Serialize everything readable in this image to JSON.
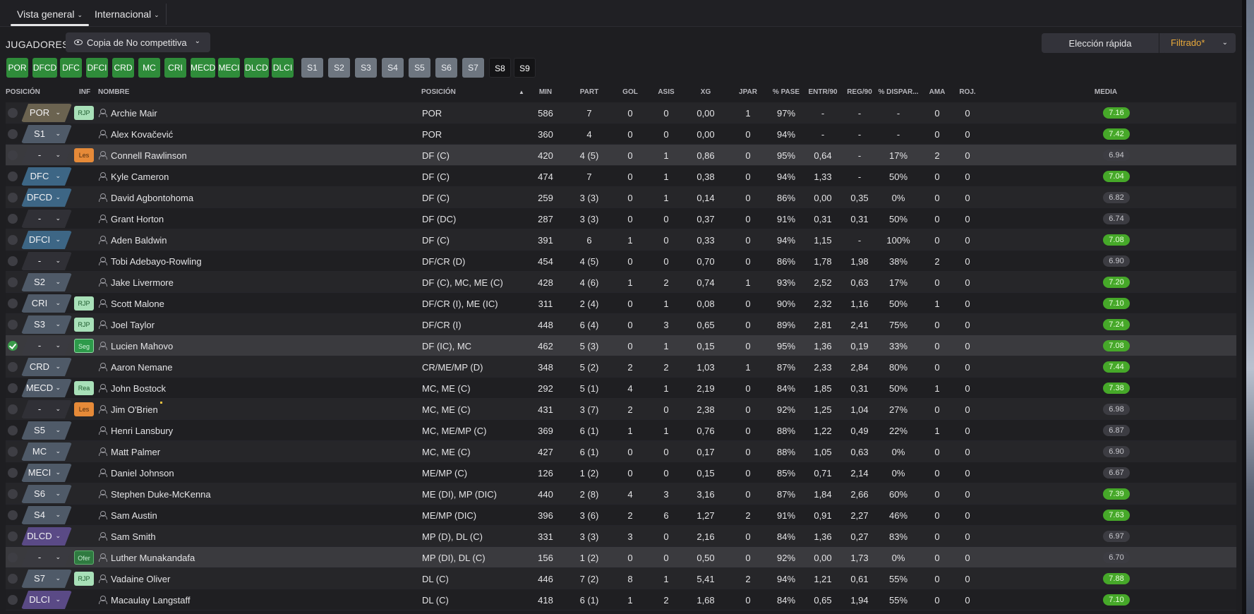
{
  "tabs": [
    {
      "label": "Vista general",
      "active": true
    },
    {
      "label": "Internacional",
      "active": false
    }
  ],
  "toolbar": {
    "title": "JUGADORES",
    "view_select": "Copia de No competitiva",
    "quick_select": "Elección rápida",
    "filtered": "Filtrado*"
  },
  "chips": [
    {
      "label": "POR",
      "style": "green"
    },
    {
      "label": "DFCD",
      "style": "green"
    },
    {
      "label": "DFC",
      "style": "green"
    },
    {
      "label": "DFCI",
      "style": "green"
    },
    {
      "label": "CRD",
      "style": "green"
    },
    {
      "label": "MC",
      "style": "green"
    },
    {
      "label": "CRI",
      "style": "green"
    },
    {
      "label": "MECD",
      "style": "green"
    },
    {
      "label": "MECI",
      "style": "green"
    },
    {
      "label": "DLCD",
      "style": "green"
    },
    {
      "label": "DLCI",
      "style": "green"
    },
    {
      "label": "S1",
      "style": "gray"
    },
    {
      "label": "S2",
      "style": "gray"
    },
    {
      "label": "S3",
      "style": "gray"
    },
    {
      "label": "S4",
      "style": "gray"
    },
    {
      "label": "S5",
      "style": "gray"
    },
    {
      "label": "S6",
      "style": "gray"
    },
    {
      "label": "S7",
      "style": "gray"
    },
    {
      "label": "S8",
      "style": "black"
    },
    {
      "label": "S9",
      "style": "black"
    }
  ],
  "columns": {
    "posicion": "POSICIÓN",
    "inf": "INF",
    "nombre": "NOMBRE",
    "posicion2": "POSICIÓN",
    "min": "MIN",
    "part": "PART",
    "gol": "GOL",
    "asis": "ASIS",
    "xg": "XG",
    "jpar": "JPAR",
    "pase": "% PASE",
    "entr": "ENTR/90",
    "reg": "REG/90",
    "dispar": "% DISPAR...",
    "ama": "AMA",
    "roj": "ROJ.",
    "media": "MEDIA"
  },
  "sort_indicator": "▲",
  "players": [
    {
      "slot": "POR",
      "slot_color": "#6b6350",
      "inf": "RJP",
      "inf_type": "rjp",
      "name": "Archie Mair",
      "position": "POR",
      "min": "586",
      "part": "7",
      "gol": "0",
      "asis": "0",
      "xg": "0,00",
      "jpar": "1",
      "pase": "97%",
      "entr": "-",
      "reg": "-",
      "dispar": "-",
      "ama": "0",
      "roj": "0",
      "media": "7.16",
      "media_type": "g",
      "checked": false
    },
    {
      "slot": "S1",
      "slot_color": "#4f5a68",
      "inf": "",
      "inf_type": "",
      "name": "Alex Kovačević",
      "position": "POR",
      "min": "360",
      "part": "4",
      "gol": "0",
      "asis": "0",
      "xg": "0,00",
      "jpar": "0",
      "pase": "94%",
      "entr": "-",
      "reg": "-",
      "dispar": "-",
      "ama": "0",
      "roj": "0",
      "media": "7.42",
      "media_type": "g",
      "checked": false
    },
    {
      "slot": "-",
      "slot_color": "#3a3a40",
      "inf": "Les",
      "inf_type": "les",
      "name": "Connell Rawlinson",
      "position": "DF (C)",
      "min": "420",
      "part": "4 (5)",
      "gol": "0",
      "asis": "1",
      "xg": "0,86",
      "jpar": "0",
      "pase": "95%",
      "entr": "0,64",
      "reg": "-",
      "dispar": "17%",
      "ama": "2",
      "roj": "0",
      "media": "6.94",
      "media_type": "n",
      "checked": false,
      "highlight": true
    },
    {
      "slot": "DFC",
      "slot_color": "#3d6685",
      "inf": "",
      "inf_type": "",
      "name": "Kyle Cameron",
      "position": "DF (C)",
      "min": "474",
      "part": "7",
      "gol": "0",
      "asis": "1",
      "xg": "0,38",
      "jpar": "0",
      "pase": "94%",
      "entr": "1,33",
      "reg": "-",
      "dispar": "50%",
      "ama": "0",
      "roj": "0",
      "media": "7.04",
      "media_type": "g",
      "checked": false
    },
    {
      "slot": "DFCD",
      "slot_color": "#3d6685",
      "inf": "",
      "inf_type": "",
      "name": "David Agbontohoma",
      "position": "DF (C)",
      "min": "259",
      "part": "3 (3)",
      "gol": "0",
      "asis": "1",
      "xg": "0,14",
      "jpar": "0",
      "pase": "86%",
      "entr": "0,00",
      "reg": "0,35",
      "dispar": "0%",
      "ama": "0",
      "roj": "0",
      "media": "6.82",
      "media_type": "n",
      "checked": false
    },
    {
      "slot": "-",
      "slot_color": "#303036",
      "inf": "",
      "inf_type": "",
      "name": "Grant Horton",
      "position": "DF (DC)",
      "min": "287",
      "part": "3 (3)",
      "gol": "0",
      "asis": "0",
      "xg": "0,37",
      "jpar": "0",
      "pase": "91%",
      "entr": "0,31",
      "reg": "0,31",
      "dispar": "50%",
      "ama": "0",
      "roj": "0",
      "media": "6.74",
      "media_type": "n",
      "checked": false
    },
    {
      "slot": "DFCI",
      "slot_color": "#3d6685",
      "inf": "",
      "inf_type": "",
      "name": "Aden Baldwin",
      "position": "DF (C)",
      "min": "391",
      "part": "6",
      "gol": "1",
      "asis": "0",
      "xg": "0,33",
      "jpar": "0",
      "pase": "94%",
      "entr": "1,15",
      "reg": "-",
      "dispar": "100%",
      "ama": "0",
      "roj": "0",
      "media": "7.08",
      "media_type": "g",
      "checked": false
    },
    {
      "slot": "-",
      "slot_color": "#303036",
      "inf": "",
      "inf_type": "",
      "name": "Tobi Adebayo-Rowling",
      "position": "DF/CR (D)",
      "min": "454",
      "part": "4 (5)",
      "gol": "0",
      "asis": "0",
      "xg": "0,70",
      "jpar": "0",
      "pase": "86%",
      "entr": "1,78",
      "reg": "1,98",
      "dispar": "38%",
      "ama": "2",
      "roj": "0",
      "media": "6.90",
      "media_type": "n",
      "checked": false
    },
    {
      "slot": "S2",
      "slot_color": "#4f5a68",
      "inf": "",
      "inf_type": "",
      "name": "Jake Livermore",
      "position": "DF (C), MC, ME (C)",
      "min": "428",
      "part": "4 (6)",
      "gol": "1",
      "asis": "2",
      "xg": "0,74",
      "jpar": "1",
      "pase": "93%",
      "entr": "2,52",
      "reg": "0,63",
      "dispar": "17%",
      "ama": "0",
      "roj": "0",
      "media": "7.20",
      "media_type": "g",
      "checked": false
    },
    {
      "slot": "CRI",
      "slot_color": "#4f5a68",
      "inf": "RJP",
      "inf_type": "rjp",
      "name": "Scott Malone",
      "position": "DF/CR (I), ME (IC)",
      "min": "311",
      "part": "2 (4)",
      "gol": "0",
      "asis": "1",
      "xg": "0,08",
      "jpar": "0",
      "pase": "90%",
      "entr": "2,32",
      "reg": "1,16",
      "dispar": "50%",
      "ama": "1",
      "roj": "0",
      "media": "7.10",
      "media_type": "g",
      "checked": false
    },
    {
      "slot": "S3",
      "slot_color": "#4f5a68",
      "inf": "RJP",
      "inf_type": "rjp",
      "name": "Joel Taylor",
      "position": "DF/CR (I)",
      "min": "448",
      "part": "6 (4)",
      "gol": "0",
      "asis": "3",
      "xg": "0,65",
      "jpar": "0",
      "pase": "89%",
      "entr": "2,81",
      "reg": "2,41",
      "dispar": "75%",
      "ama": "0",
      "roj": "0",
      "media": "7.24",
      "media_type": "g",
      "checked": false
    },
    {
      "slot": "-",
      "slot_color": "#3a3a40",
      "inf": "Seg",
      "inf_type": "seg",
      "name": "Lucien Mahovo",
      "position": "DF (IC), MC",
      "min": "462",
      "part": "5 (3)",
      "gol": "0",
      "asis": "1",
      "xg": "0,15",
      "jpar": "0",
      "pase": "95%",
      "entr": "1,36",
      "reg": "0,19",
      "dispar": "33%",
      "ama": "0",
      "roj": "0",
      "media": "7.08",
      "media_type": "g",
      "checked": true,
      "highlight": true
    },
    {
      "slot": "CRD",
      "slot_color": "#4f5a68",
      "inf": "",
      "inf_type": "",
      "name": "Aaron Nemane",
      "position": "CR/ME/MP (D)",
      "min": "348",
      "part": "5 (2)",
      "gol": "2",
      "asis": "2",
      "xg": "1,03",
      "jpar": "1",
      "pase": "87%",
      "entr": "2,33",
      "reg": "2,84",
      "dispar": "80%",
      "ama": "0",
      "roj": "0",
      "media": "7.44",
      "media_type": "g",
      "checked": false
    },
    {
      "slot": "MECD",
      "slot_color": "#4f5a68",
      "inf": "Rea",
      "inf_type": "rea",
      "name": "John Bostock",
      "position": "MC, ME (C)",
      "min": "292",
      "part": "5 (1)",
      "gol": "4",
      "asis": "1",
      "xg": "2,19",
      "jpar": "0",
      "pase": "84%",
      "entr": "1,85",
      "reg": "0,31",
      "dispar": "50%",
      "ama": "1",
      "roj": "0",
      "media": "7.38",
      "media_type": "g",
      "checked": false
    },
    {
      "slot": "-",
      "slot_color": "#303036",
      "inf": "Les",
      "inf_type": "les",
      "name": "Jim O'Brien",
      "position": "MC, ME (C)",
      "min": "431",
      "part": "3 (7)",
      "gol": "2",
      "asis": "0",
      "xg": "2,38",
      "jpar": "0",
      "pase": "92%",
      "entr": "1,25",
      "reg": "1,04",
      "dispar": "27%",
      "ama": "0",
      "roj": "0",
      "media": "6.98",
      "media_type": "n",
      "checked": false
    },
    {
      "slot": "S5",
      "slot_color": "#4f5a68",
      "inf": "",
      "inf_type": "",
      "name": "Henri Lansbury",
      "position": "MC, ME/MP (C)",
      "min": "369",
      "part": "6 (1)",
      "gol": "1",
      "asis": "1",
      "xg": "0,76",
      "jpar": "0",
      "pase": "88%",
      "entr": "1,22",
      "reg": "0,49",
      "dispar": "22%",
      "ama": "1",
      "roj": "0",
      "media": "6.87",
      "media_type": "n",
      "checked": false
    },
    {
      "slot": "MC",
      "slot_color": "#4f5a68",
      "inf": "",
      "inf_type": "",
      "name": "Matt Palmer",
      "position": "MC, ME (C)",
      "min": "427",
      "part": "6 (1)",
      "gol": "0",
      "asis": "0",
      "xg": "0,17",
      "jpar": "0",
      "pase": "88%",
      "entr": "1,05",
      "reg": "0,63",
      "dispar": "0%",
      "ama": "0",
      "roj": "0",
      "media": "6.90",
      "media_type": "n",
      "checked": false
    },
    {
      "slot": "MECI",
      "slot_color": "#4f5a68",
      "inf": "",
      "inf_type": "",
      "name": "Daniel Johnson",
      "position": "ME/MP (C)",
      "min": "126",
      "part": "1 (2)",
      "gol": "0",
      "asis": "0",
      "xg": "0,15",
      "jpar": "0",
      "pase": "85%",
      "entr": "0,71",
      "reg": "2,14",
      "dispar": "0%",
      "ama": "0",
      "roj": "0",
      "media": "6.67",
      "media_type": "n",
      "checked": false
    },
    {
      "slot": "S6",
      "slot_color": "#4f5a68",
      "inf": "",
      "inf_type": "",
      "name": "Stephen Duke-McKenna",
      "position": "ME (DI), MP (DIC)",
      "min": "440",
      "part": "2 (8)",
      "gol": "4",
      "asis": "3",
      "xg": "3,16",
      "jpar": "0",
      "pase": "87%",
      "entr": "1,84",
      "reg": "2,66",
      "dispar": "60%",
      "ama": "0",
      "roj": "0",
      "media": "7.39",
      "media_type": "g",
      "checked": false
    },
    {
      "slot": "S4",
      "slot_color": "#4f5a68",
      "inf": "",
      "inf_type": "",
      "name": "Sam Austin",
      "position": "ME/MP (DIC)",
      "min": "396",
      "part": "3 (6)",
      "gol": "2",
      "asis": "6",
      "xg": "1,27",
      "jpar": "2",
      "pase": "91%",
      "entr": "0,91",
      "reg": "2,27",
      "dispar": "46%",
      "ama": "0",
      "roj": "0",
      "media": "7.63",
      "media_type": "g",
      "checked": false
    },
    {
      "slot": "DLCD",
      "slot_color": "#5a4a86",
      "inf": "",
      "inf_type": "",
      "name": "Sam Smith",
      "position": "MP (D), DL (C)",
      "min": "331",
      "part": "3 (3)",
      "gol": "3",
      "asis": "0",
      "xg": "2,16",
      "jpar": "0",
      "pase": "84%",
      "entr": "1,36",
      "reg": "0,27",
      "dispar": "83%",
      "ama": "0",
      "roj": "0",
      "media": "6.97",
      "media_type": "n",
      "checked": false
    },
    {
      "slot": "-",
      "slot_color": "#3a3a40",
      "inf": "Ofer",
      "inf_type": "ofer",
      "name": "Luther Munakandafa",
      "position": "MP (DI), DL (C)",
      "min": "156",
      "part": "1 (2)",
      "gol": "0",
      "asis": "0",
      "xg": "0,50",
      "jpar": "0",
      "pase": "92%",
      "entr": "0,00",
      "reg": "1,73",
      "dispar": "0%",
      "ama": "0",
      "roj": "0",
      "media": "6.70",
      "media_type": "n",
      "checked": false,
      "highlight": true
    },
    {
      "slot": "S7",
      "slot_color": "#4f5a68",
      "inf": "RJP",
      "inf_type": "rjp",
      "name": "Vadaine Oliver",
      "position": "DL (C)",
      "min": "446",
      "part": "7 (2)",
      "gol": "8",
      "asis": "1",
      "xg": "5,41",
      "jpar": "2",
      "pase": "94%",
      "entr": "1,21",
      "reg": "0,61",
      "dispar": "55%",
      "ama": "0",
      "roj": "0",
      "media": "7.88",
      "media_type": "g",
      "checked": false
    },
    {
      "slot": "DLCI",
      "slot_color": "#5a4a86",
      "inf": "",
      "inf_type": "",
      "name": "Macaulay Langstaff",
      "position": "DL (C)",
      "min": "418",
      "part": "6 (1)",
      "gol": "1",
      "asis": "2",
      "xg": "1,68",
      "jpar": "0",
      "pase": "84%",
      "entr": "0,65",
      "reg": "1,94",
      "dispar": "55%",
      "ama": "0",
      "roj": "0",
      "media": "7.10",
      "media_type": "g",
      "checked": false
    }
  ]
}
